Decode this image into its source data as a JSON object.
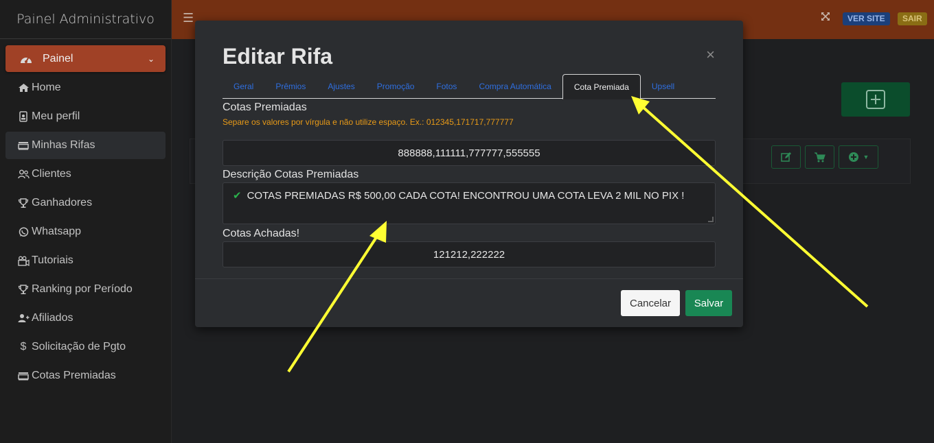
{
  "sidebar": {
    "brand": "Painel Administrativo",
    "active_item": {
      "label": "Painel",
      "icon": "gauge-icon"
    },
    "items": [
      {
        "label": "Home",
        "icon": "home-icon"
      },
      {
        "label": "Meu perfil",
        "icon": "id-badge-icon"
      },
      {
        "label": "Minhas Rifas",
        "icon": "ticket-icon"
      },
      {
        "label": "Clientes",
        "icon": "users-icon"
      },
      {
        "label": "Ganhadores",
        "icon": "trophy-icon"
      },
      {
        "label": "Whatsapp",
        "icon": "whatsapp-icon"
      },
      {
        "label": "Tutoriais",
        "icon": "video-icon"
      },
      {
        "label": "Ranking por Período",
        "icon": "trophy-icon"
      },
      {
        "label": "Afiliados",
        "icon": "user-plus-icon"
      },
      {
        "label": "Solicitação de Pgto",
        "icon": "dollar-icon"
      },
      {
        "label": "Cotas Premiadas",
        "icon": "ticket-icon"
      }
    ]
  },
  "topbar": {
    "ver_site": "VER SITE",
    "sair": "SAIR"
  },
  "modal": {
    "title": "Editar Rifa",
    "close": "×",
    "tabs": [
      "Geral",
      "Prêmios",
      "Ajustes",
      "Promoção",
      "Fotos",
      "Compra Automática",
      "Cota Premiada",
      "Upsell"
    ],
    "active_tab": "Cota Premiada",
    "cotas_label": "Cotas Premiadas",
    "cotas_hint": "Separe os valores por vírgula e não utilize espaço. Ex.: 012345,171717,777777",
    "cotas_value": "888888,111111,777777,555555",
    "descricao_label": "Descrição Cotas Premiadas",
    "descricao_value": "COTAS PREMIADAS R$ 500,00 CADA COTA! ENCONTROU UMA COTA  LEVA 2 MIL NO PIX !",
    "achadas_label": "Cotas Achadas!",
    "achadas_value": "121212,222222",
    "cancel": "Cancelar",
    "save": "Salvar"
  },
  "colors": {
    "topbar": "#743012",
    "active_nav": "#a04126",
    "save": "#198754",
    "hint": "#e89a17",
    "tab_link": "#2f6fe0",
    "arrow": "#ffff33"
  }
}
